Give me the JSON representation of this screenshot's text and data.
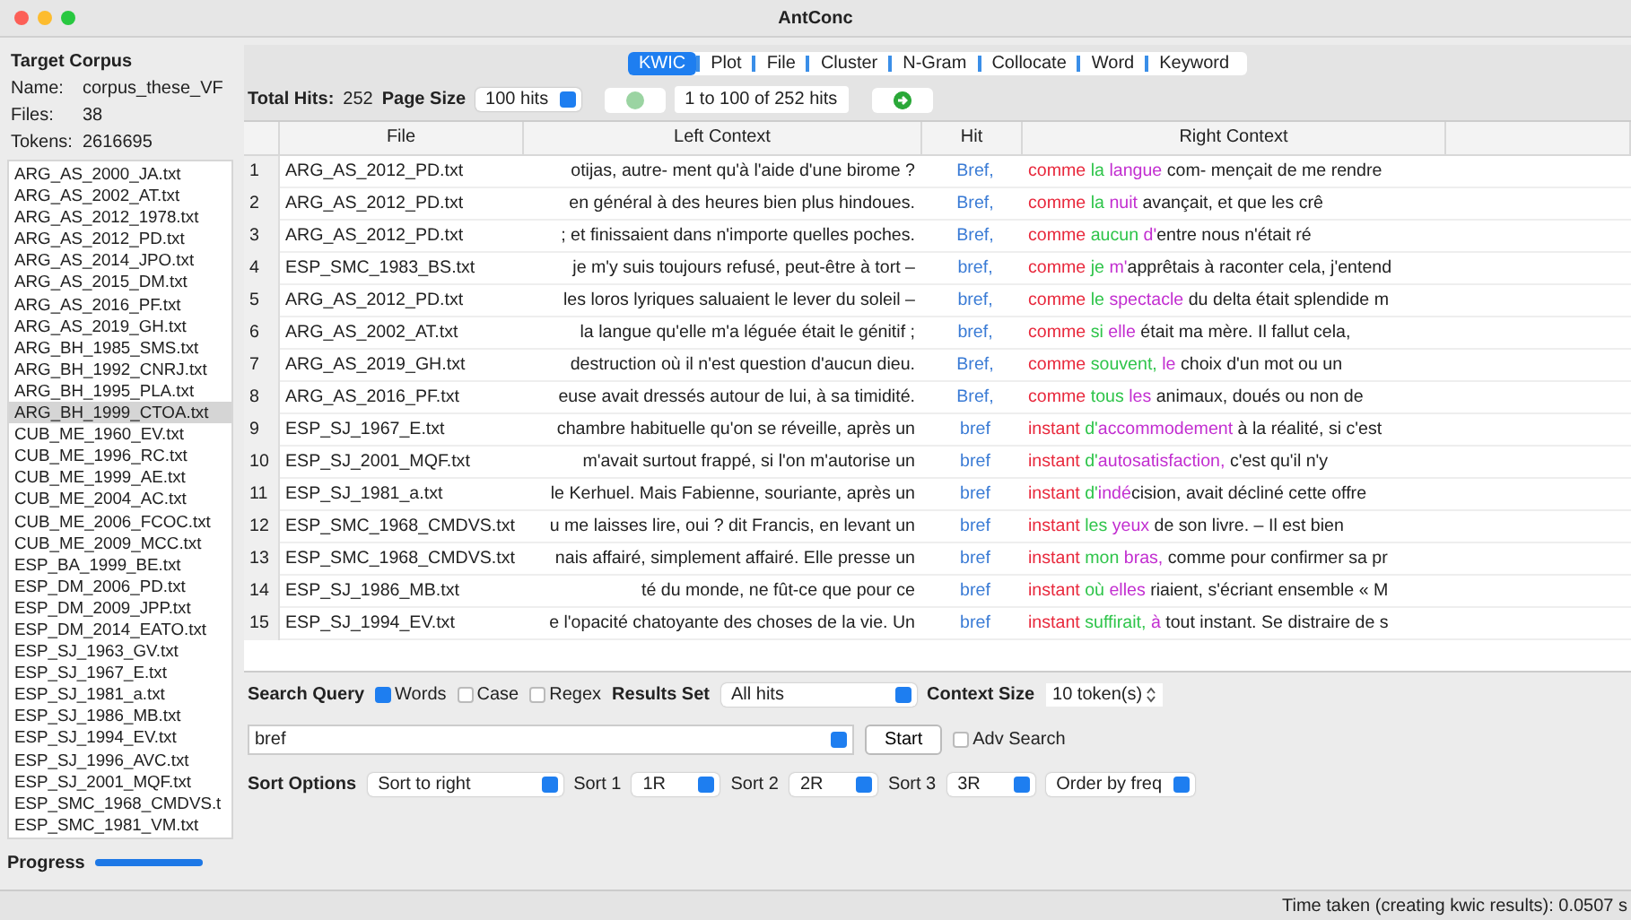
{
  "window": {
    "title": "AntConc"
  },
  "corpus": {
    "heading": "Target Corpus",
    "name_label": "Name:",
    "name": "corpus_these_VF",
    "files_label": "Files:",
    "files": "38",
    "tokens_label": "Tokens:",
    "tokens": "2616695",
    "files_list": [
      {
        "name": "ARG_AS_2000_JA.txt",
        "selected": false
      },
      {
        "name": "ARG_AS_2002_AT.txt",
        "selected": false
      },
      {
        "name": "ARG_AS_2012_1978.txt",
        "selected": false
      },
      {
        "name": "ARG_AS_2012_PD.txt",
        "selected": false
      },
      {
        "name": "ARG_AS_2014_JPO.txt",
        "selected": false
      },
      {
        "name": "ARG_AS_2015_DM.txt",
        "selected": false
      },
      {
        "name": "ARG_AS_2016_PF.txt",
        "selected": false
      },
      {
        "name": "ARG_AS_2019_GH.txt",
        "selected": false
      },
      {
        "name": "ARG_BH_1985_SMS.txt",
        "selected": false
      },
      {
        "name": "ARG_BH_1992_CNRJ.txt",
        "selected": false
      },
      {
        "name": "ARG_BH_1995_PLA.txt",
        "selected": false
      },
      {
        "name": "ARG_BH_1999_CTOA.txt",
        "selected": true
      },
      {
        "name": "CUB_ME_1960_EV.txt",
        "selected": false
      },
      {
        "name": "CUB_ME_1996_RC.txt",
        "selected": false
      },
      {
        "name": "CUB_ME_1999_AE.txt",
        "selected": false
      },
      {
        "name": "CUB_ME_2004_AC.txt",
        "selected": false
      },
      {
        "name": "CUB_ME_2006_FCOC.txt",
        "selected": false
      },
      {
        "name": "CUB_ME_2009_MCC.txt",
        "selected": false
      },
      {
        "name": "ESP_BA_1999_BE.txt",
        "selected": false
      },
      {
        "name": "ESP_DM_2006_PD.txt",
        "selected": false
      },
      {
        "name": "ESP_DM_2009_JPP.txt",
        "selected": false
      },
      {
        "name": "ESP_DM_2014_EATO.txt",
        "selected": false
      },
      {
        "name": "ESP_SJ_1963_GV.txt",
        "selected": false
      },
      {
        "name": "ESP_SJ_1967_E.txt",
        "selected": false
      },
      {
        "name": "ESP_SJ_1981_a.txt",
        "selected": false
      },
      {
        "name": "ESP_SJ_1986_MB.txt",
        "selected": false
      },
      {
        "name": "ESP_SJ_1994_EV.txt",
        "selected": false
      },
      {
        "name": "ESP_SJ_1996_AVC.txt",
        "selected": false
      },
      {
        "name": "ESP_SJ_2001_MQF.txt",
        "selected": false
      },
      {
        "name": "ESP_SMC_1968_CMDVS.t",
        "selected": false
      },
      {
        "name": "ESP_SMC_1981_VM.txt",
        "selected": false
      }
    ],
    "progress": {
      "label": "Progress",
      "level": 1
    }
  },
  "tabs": [
    {
      "label": "KWIC",
      "selected": true
    },
    {
      "label": "Plot",
      "selected": false
    },
    {
      "label": "File",
      "selected": false
    },
    {
      "label": "Cluster",
      "selected": false
    },
    {
      "label": "N-Gram",
      "selected": false
    },
    {
      "label": "Collocate",
      "selected": false
    },
    {
      "label": "Word",
      "selected": false
    },
    {
      "label": "Keyword",
      "selected": false
    }
  ],
  "hits_bar": {
    "total_label": "Total Hits:",
    "total": "252",
    "page_size_label": "Page Size",
    "page_size": "100 hits",
    "page_range": "1 to 100 of 252 hits"
  },
  "table": {
    "columns": [
      "File",
      "Left Context",
      "Hit",
      "Right Context"
    ],
    "rows": [
      {
        "n": "1",
        "file": "ARG_AS_2012_PD.txt",
        "left": "otijas, autre- ment qu'à l'aide d'une birome ?",
        "hit": "Bref,",
        "right": [
          {
            "text": "comme",
            "color": "#e8283c"
          },
          {
            "text": " la",
            "color": "#2ec44a"
          },
          {
            "text": " langue",
            "color": "#c22ed0"
          },
          {
            "text": " com- mençait de me rendre"
          }
        ]
      },
      {
        "n": "2",
        "file": "ARG_AS_2012_PD.txt",
        "left": "en général à des heures bien plus hindoues.",
        "hit": "Bref,",
        "right": [
          {
            "text": "comme",
            "color": "#e8283c"
          },
          {
            "text": " la",
            "color": "#2ec44a"
          },
          {
            "text": " nuit",
            "color": "#c22ed0"
          },
          {
            "text": " avançait, et que les crê"
          }
        ]
      },
      {
        "n": "3",
        "file": "ARG_AS_2012_PD.txt",
        "left": "; et finissaient dans n'importe quelles poches.",
        "hit": "Bref,",
        "right": [
          {
            "text": "comme",
            "color": "#e8283c"
          },
          {
            "text": " aucun",
            "color": "#2ec44a"
          },
          {
            "text": " d'",
            "color": "#c22ed0"
          },
          {
            "text": "entre nous n'était ré"
          }
        ]
      },
      {
        "n": "4",
        "file": "ESP_SMC_1983_BS.txt",
        "left": "je m'y suis toujours refusé, peut-être à tort –",
        "hit": "bref,",
        "right": [
          {
            "text": "comme",
            "color": "#e8283c"
          },
          {
            "text": " je",
            "color": "#2ec44a"
          },
          {
            "text": " m'",
            "color": "#c22ed0"
          },
          {
            "text": "apprêtais à raconter cela, j'entend"
          }
        ]
      },
      {
        "n": "5",
        "file": "ARG_AS_2012_PD.txt",
        "left": "les loros lyriques saluaient le lever du soleil –",
        "hit": "bref,",
        "right": [
          {
            "text": "comme",
            "color": "#e8283c"
          },
          {
            "text": " le",
            "color": "#2ec44a"
          },
          {
            "text": " spectacle",
            "color": "#c22ed0"
          },
          {
            "text": " du delta était splendide m"
          }
        ]
      },
      {
        "n": "6",
        "file": "ARG_AS_2002_AT.txt",
        "left": "la langue qu'elle m'a léguée était le génitif ;",
        "hit": "bref,",
        "right": [
          {
            "text": "comme",
            "color": "#e8283c"
          },
          {
            "text": " si",
            "color": "#2ec44a"
          },
          {
            "text": " elle",
            "color": "#c22ed0"
          },
          {
            "text": " était ma mère. Il fallut cela,"
          }
        ]
      },
      {
        "n": "7",
        "file": "ARG_AS_2019_GH.txt",
        "left": "destruction où il n'est question d'aucun dieu.",
        "hit": "Bref,",
        "right": [
          {
            "text": "comme",
            "color": "#e8283c"
          },
          {
            "text": " souvent,",
            "color": "#2ec44a"
          },
          {
            "text": " le",
            "color": "#c22ed0"
          },
          {
            "text": " choix d'un mot ou un"
          }
        ]
      },
      {
        "n": "8",
        "file": "ARG_AS_2016_PF.txt",
        "left": "euse avait dressés autour de lui, à sa timidité.",
        "hit": "Bref,",
        "right": [
          {
            "text": "comme",
            "color": "#e8283c"
          },
          {
            "text": " tous",
            "color": "#2ec44a"
          },
          {
            "text": " les",
            "color": "#c22ed0"
          },
          {
            "text": " animaux, doués ou non de"
          }
        ]
      },
      {
        "n": "9",
        "file": "ESP_SJ_1967_E.txt",
        "left": "chambre habituelle qu'on se réveille, après un",
        "hit": "bref",
        "right": [
          {
            "text": "instant",
            "color": "#e8283c"
          },
          {
            "text": " d'",
            "color": "#2ec44a"
          },
          {
            "text": "accommodement",
            "color": "#c22ed0"
          },
          {
            "text": " à la réalité, si c'est"
          }
        ]
      },
      {
        "n": "10",
        "file": "ESP_SJ_2001_MQF.txt",
        "left": "m'avait surtout frappé, si l'on m'autorise un",
        "hit": "bref",
        "right": [
          {
            "text": "instant",
            "color": "#e8283c"
          },
          {
            "text": " d'",
            "color": "#2ec44a"
          },
          {
            "text": "autosatisfaction,",
            "color": "#c22ed0"
          },
          {
            "text": " c'est qu'il n'y"
          }
        ]
      },
      {
        "n": "11",
        "file": "ESP_SJ_1981_a.txt",
        "left": "le Kerhuel. Mais Fabienne, souriante, après un",
        "hit": "bref",
        "right": [
          {
            "text": "instant",
            "color": "#e8283c"
          },
          {
            "text": " d'",
            "color": "#2ec44a"
          },
          {
            "text": "indé",
            "color": "#c22ed0"
          },
          {
            "text": "cision, avait décliné cette offre"
          }
        ]
      },
      {
        "n": "12",
        "file": "ESP_SMC_1968_CMDVS.txt",
        "left": "u me laisses lire, oui ? dit Francis, en levant un",
        "hit": "bref",
        "right": [
          {
            "text": "instant",
            "color": "#e8283c"
          },
          {
            "text": " les",
            "color": "#2ec44a"
          },
          {
            "text": " yeux",
            "color": "#c22ed0"
          },
          {
            "text": " de son livre. – Il est bien"
          }
        ]
      },
      {
        "n": "13",
        "file": "ESP_SMC_1968_CMDVS.txt",
        "left": "nais affairé, simplement affairé. Elle presse un",
        "hit": "bref",
        "right": [
          {
            "text": "instant",
            "color": "#e8283c"
          },
          {
            "text": " mon",
            "color": "#2ec44a"
          },
          {
            "text": " bras,",
            "color": "#c22ed0"
          },
          {
            "text": " comme pour confirmer sa pr"
          }
        ]
      },
      {
        "n": "14",
        "file": "ESP_SJ_1986_MB.txt",
        "left": "té du monde, ne fût-ce que pour ce",
        "hit": "bref",
        "right": [
          {
            "text": "instant",
            "color": "#e8283c"
          },
          {
            "text": " où",
            "color": "#2ec44a"
          },
          {
            "text": " elles",
            "color": "#c22ed0"
          },
          {
            "text": " riaient, s'écriant ensemble « M"
          }
        ]
      },
      {
        "n": "15",
        "file": "ESP_SJ_1994_EV.txt",
        "left": "e l'opacité chatoyante des choses de la vie. Un",
        "hit": "bref",
        "right": [
          {
            "text": "instant",
            "color": "#e8283c"
          },
          {
            "text": " suffirait,",
            "color": "#2ec44a"
          },
          {
            "text": " à",
            "color": "#c22ed0"
          },
          {
            "text": " tout instant. Se distraire de s"
          }
        ]
      }
    ]
  },
  "search": {
    "label": "Search Query",
    "options": [
      {
        "label": "Words",
        "checked": true
      },
      {
        "label": "Case",
        "checked": false
      },
      {
        "label": "Regex",
        "checked": false
      }
    ],
    "results_label": "Results Set",
    "results": "All hits",
    "context_label": "Context Size",
    "context": "10 token(s)",
    "query": "bref",
    "start": "Start",
    "adv": {
      "label": "Adv Search",
      "checked": false
    }
  },
  "sort": {
    "label": "Sort Options",
    "mode": "Sort to right",
    "levels": [
      {
        "label": "Sort 1",
        "value": "1R"
      },
      {
        "label": "Sort 2",
        "value": "2R"
      },
      {
        "label": "Sort 3",
        "value": "3R"
      }
    ],
    "order": "Order by freq"
  },
  "status_bar": "Time taken (creating kwic results): 0.0507 s"
}
